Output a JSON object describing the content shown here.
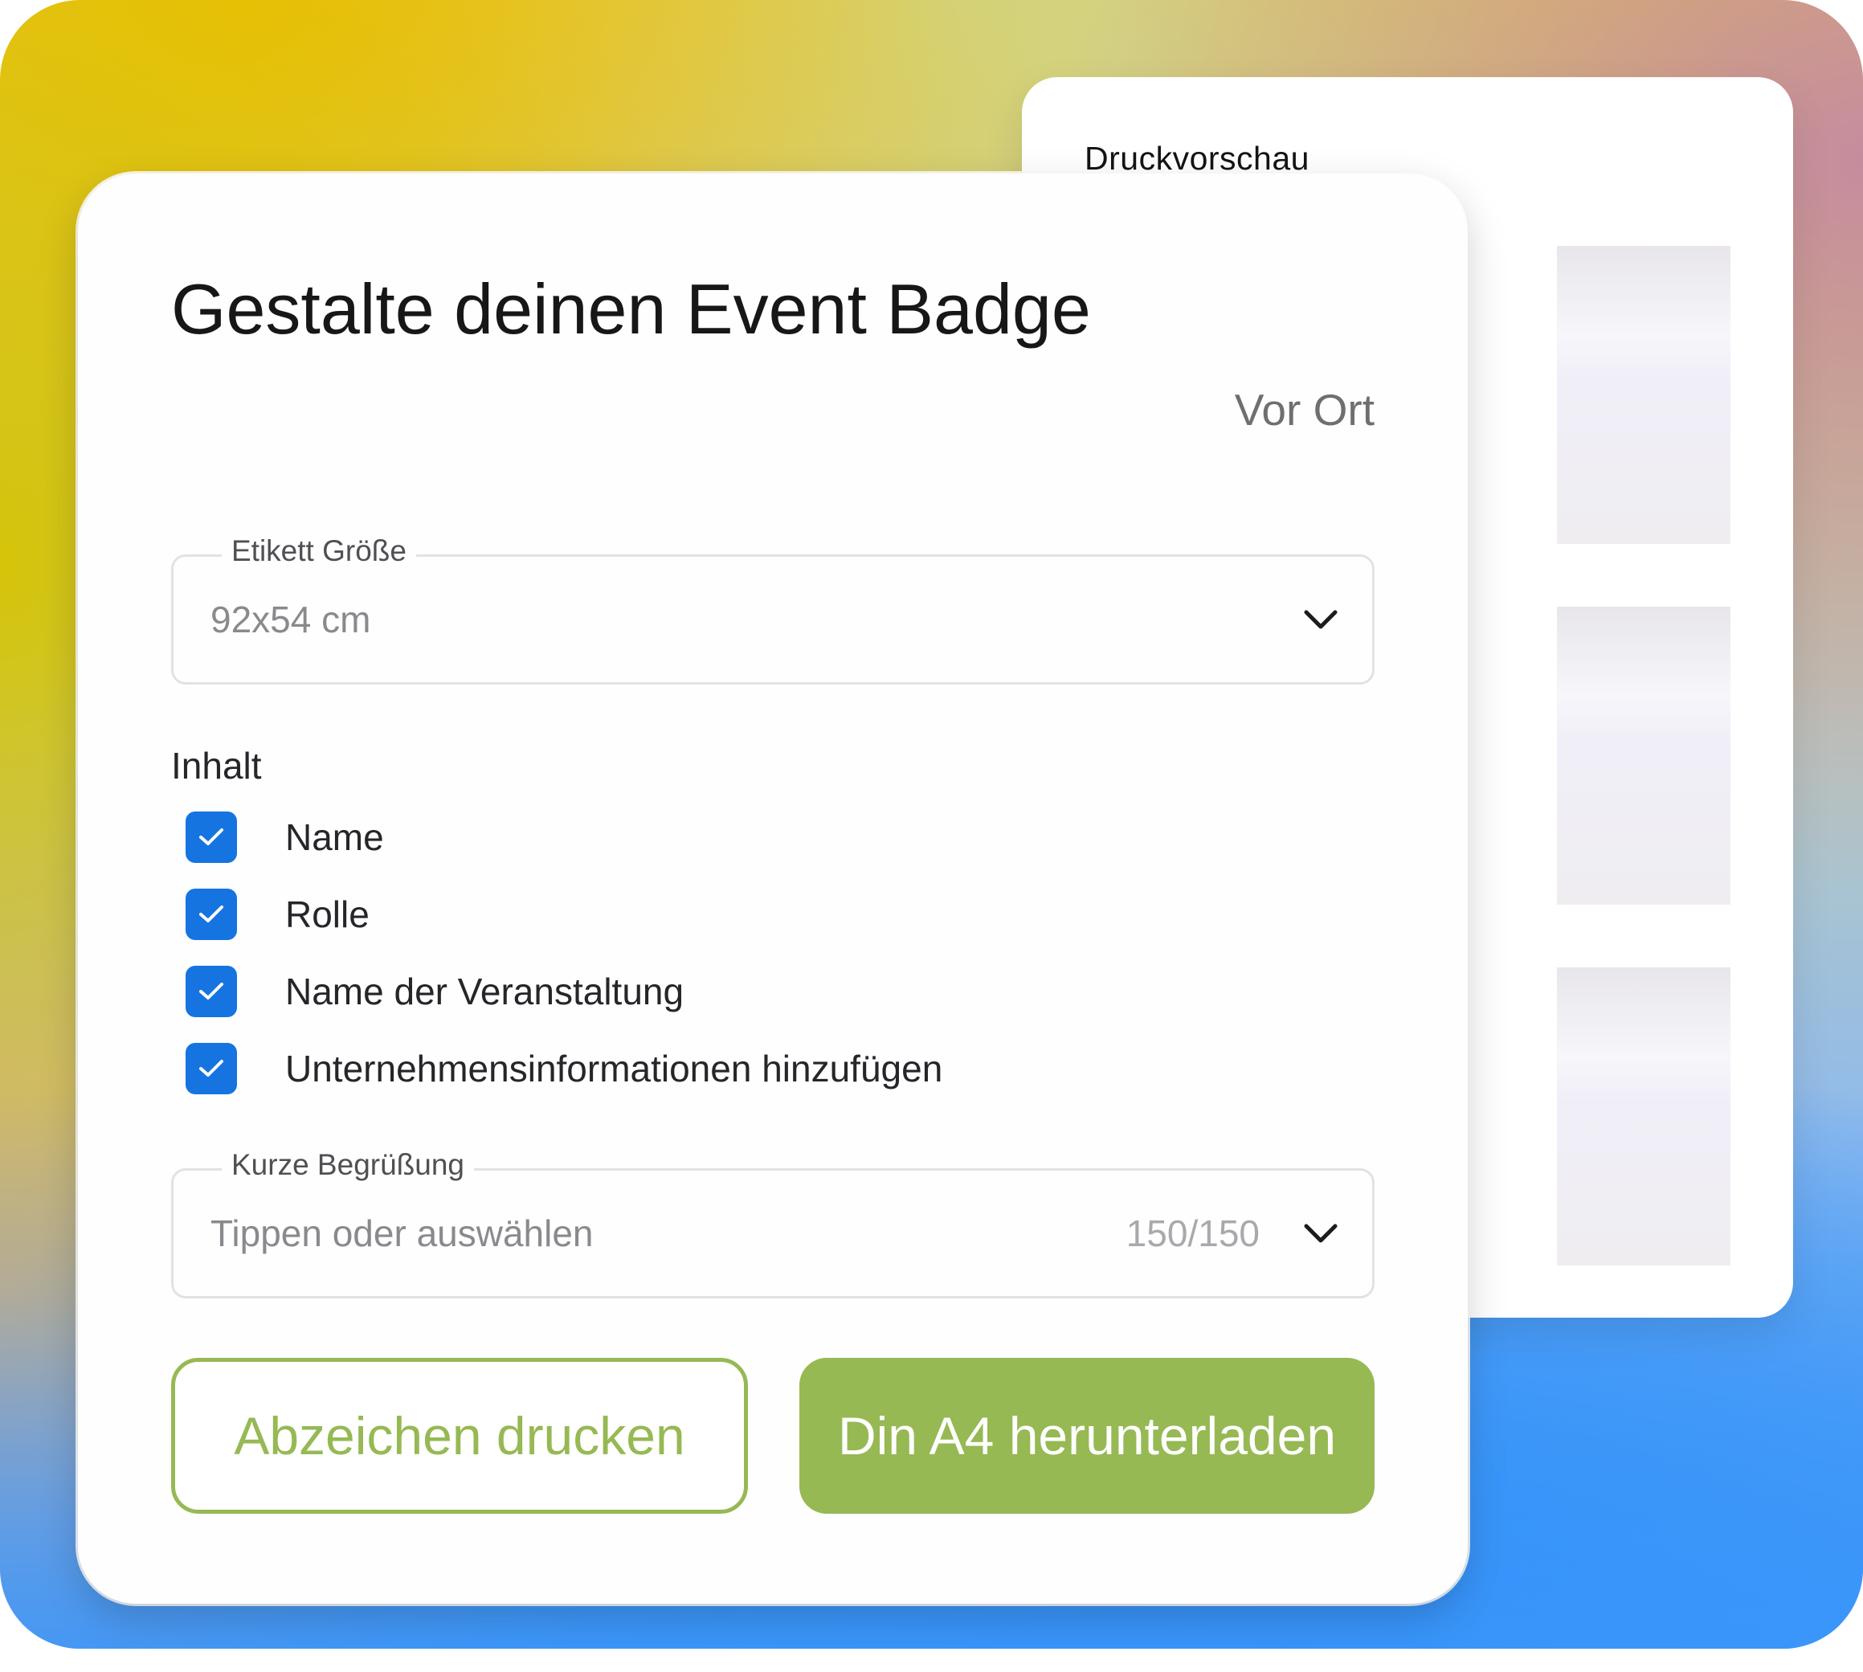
{
  "preview": {
    "title": "Druckvorschau"
  },
  "form": {
    "title": "Gestalte deinen Event Badge",
    "mode": "Vor Ort",
    "label_size": {
      "legend": "Etikett Größe",
      "value": "92x54 cm"
    },
    "content": {
      "heading": "Inhalt",
      "options": [
        {
          "label": "Name",
          "checked": true
        },
        {
          "label": "Rolle",
          "checked": true
        },
        {
          "label": "Name der Veranstaltung",
          "checked": true
        },
        {
          "label": "Unternehmensinformationen hinzufügen",
          "checked": true
        }
      ]
    },
    "greeting": {
      "legend": "Kurze Begrüßung",
      "placeholder": "Tippen oder auswählen",
      "counter": "150/150"
    },
    "buttons": {
      "print": "Abzeichen drucken",
      "download": "Din A4 herunterladen"
    }
  },
  "colors": {
    "accent_green": "#96b954",
    "checkbox_blue": "#1574e0",
    "text_dark": "#171717"
  },
  "icons": {
    "dropdown": "chevron-down-icon",
    "check": "check-icon"
  }
}
